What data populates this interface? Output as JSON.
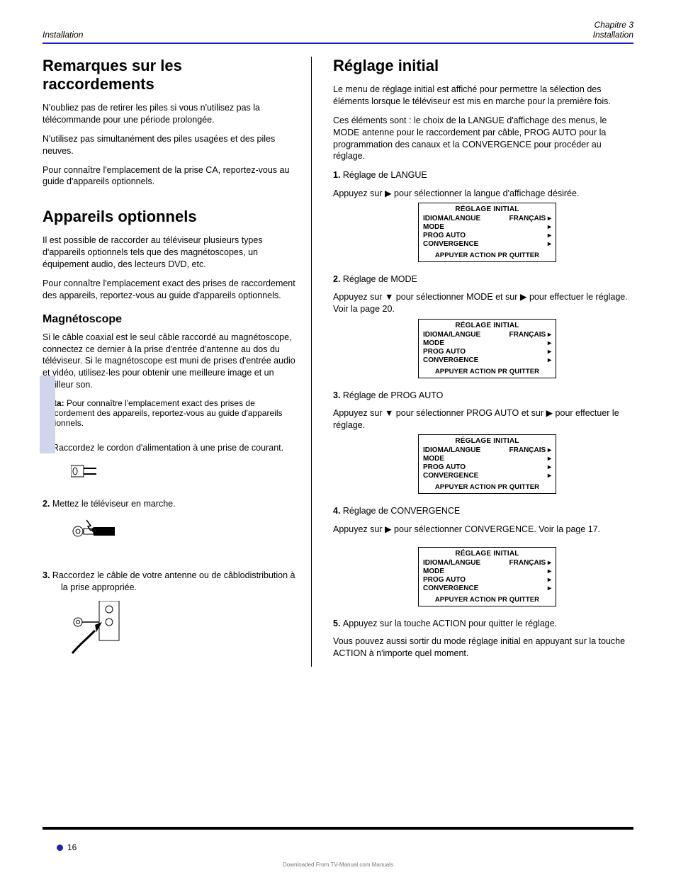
{
  "header": {
    "left": "Installation",
    "right_top": "Chapitre 3",
    "right_bottom": "Installation"
  },
  "left": {
    "h_remark": "Remarques sur les raccordements",
    "p1": "N'oubliez pas de retirer les piles si vous n'utilisez pas la télécommande pour une période prolongée.",
    "p2": "N'utilisez pas simultanément des piles usagées et des piles neuves.",
    "p3": "Pour connaître l'emplacement de la prise CA, reportez-vous au guide d'appareils optionnels.",
    "h_equipment": "Appareils optionnels",
    "eq1": "Il est possible de raccorder au téléviseur plusieurs types d'appareils optionnels tels que des magnétoscopes, un équipement audio, des lecteurs DVD, etc.",
    "eq2": "Pour connaître l'emplacement exact des prises de raccordement des appareils, reportez-vous au guide d'appareils optionnels.",
    "h_vcr": "Magnétoscope",
    "vcr1": "Si le câble coaxial est le seul câble raccordé au magnétoscope, connectez ce dernier à la prise d'entrée d'antenne au dos du téléviseur. Si le magnétoscope est muni de prises d'entrée audio et vidéo, utilisez-les pour obtenir une meilleure image et un meilleur son.",
    "note_label": "Nota:",
    "note_body": "Pour connaître l'emplacement exact des prises de raccordement des appareils, reportez-vous au guide d'appareils optionnels.",
    "step1": "Raccordez le cordon d'alimentation à une prise de courant.",
    "step2": "Mettez le téléviseur en marche.",
    "step3": "Raccordez le câble de votre antenne ou de câblodistribution à la prise appropriée."
  },
  "right": {
    "h_setup": "Réglage initial",
    "intro1": "Le menu de réglage initial est affiché pour permettre la sélection des éléments lorsque le téléviseur est mis en marche pour la première fois.",
    "intro2": "Ces éléments sont : le choix de la LANGUE d'affichage des menus, le MODE antenne pour le raccordement par câble, PROG AUTO pour la programmation des canaux et la CONVERGENCE pour procéder au réglage.",
    "step1_a": "Réglage de LANGUE",
    "step1_b": "Appuyez sur ▶ pour sélectionner la langue d'affichage désirée.",
    "step2_a": "Réglage de MODE",
    "step2_b": "Appuyez sur ▼ pour sélectionner MODE et sur ▶ pour effectuer le réglage. Voir la page 20.",
    "step3_a": "Réglage de PROG AUTO",
    "step3_b": "Appuyez sur ▼ pour sélectionner PROG AUTO et sur ▶ pour effectuer le réglage.",
    "step4_a": "Réglage de CONVERGENCE",
    "step4_b": "Appuyez sur ▶ pour sélectionner CONVERGENCE. Voir la page 17.",
    "end1": "Appuyez sur la touche ACTION pour quitter le réglage.",
    "end2": "Vous pouvez aussi sortir du mode réglage initial en appuyant sur la touche ACTION à n'importe quel moment."
  },
  "menus": {
    "title": "RÉGLAGE INITIAL",
    "footer": "APPUYER ACTION PR QUITTER",
    "row_lang_label": "IDIOMA/LANGUE",
    "row_lang_val": "FRANÇAIS ▸",
    "row_mode": "MODE",
    "row_prog": "PROG AUTO",
    "row_conv": "CONVERGENCE",
    "arrow": "▸"
  },
  "footer": {
    "page": "16",
    "credit": "Downloaded From TV-Manual.com Manuals"
  }
}
